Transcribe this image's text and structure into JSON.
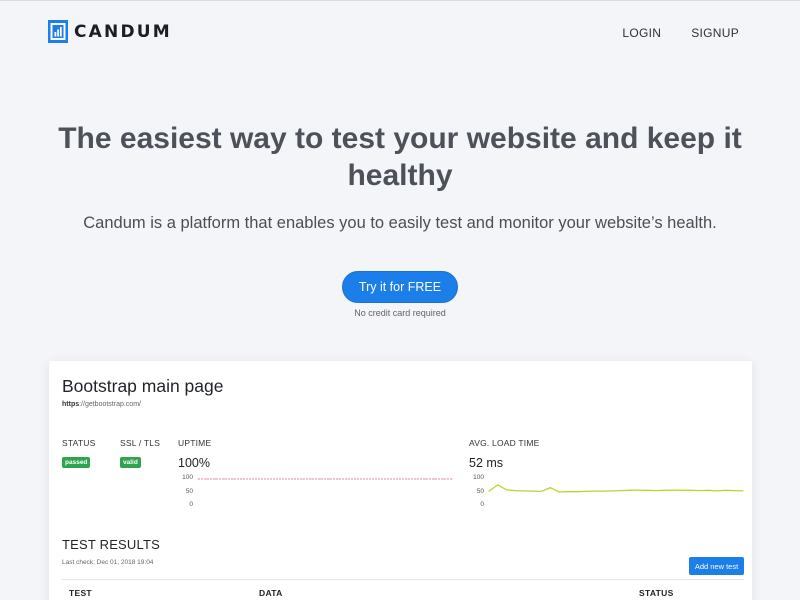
{
  "header": {
    "logo_text": "CANDUM",
    "nav": {
      "login": "LOGIN",
      "signup": "SIGNUP"
    }
  },
  "hero": {
    "title": "The easiest way to test your website and keep it healthy",
    "subtitle": "Candum is a platform that enables you to easily test and monitor your website’s health.",
    "cta_label": "Try it for FREE",
    "cta_note": "No credit card required"
  },
  "card": {
    "title": "Bootstrap main page",
    "url_scheme": "https",
    "url_rest": "://getbootstrap.com/",
    "status_label": "STATUS",
    "status_badge": "passed",
    "ssl_label": "SSL / TLS",
    "ssl_badge": "valid",
    "uptime": {
      "label": "UPTIME",
      "value": "100%",
      "ticks": [
        "100",
        "50",
        "0"
      ]
    },
    "load": {
      "label": "AVG. LOAD TIME",
      "value": "52 ms",
      "ticks": [
        "100",
        "50",
        "0"
      ]
    },
    "results": {
      "title": "TEST RESULTS",
      "last_check": "Last check: Dec 01, 2018 19:04",
      "add_label": "Add new test",
      "columns": [
        "TEST",
        "DATA",
        "STATUS"
      ]
    }
  },
  "colors": {
    "accent": "#1c7ee8",
    "badge_green": "#2ea44f",
    "uptime_line": "#e8a3ad",
    "load_line": "#b6d82c"
  },
  "chart_data": [
    {
      "type": "line",
      "name": "uptime",
      "ylim": [
        0,
        100
      ],
      "yticks": [
        100,
        50,
        0
      ],
      "values": [
        100,
        100,
        100,
        100,
        100,
        100,
        100,
        100,
        100,
        100,
        100,
        100,
        100,
        100,
        100,
        100,
        100,
        100,
        100,
        100,
        100,
        100,
        100,
        100,
        100,
        100,
        100,
        100,
        100,
        100
      ]
    },
    {
      "type": "line",
      "name": "avg_load_time",
      "ylim": [
        0,
        100
      ],
      "yticks": [
        100,
        50,
        0
      ],
      "values": [
        55,
        78,
        60,
        57,
        56,
        55,
        54,
        68,
        52,
        53,
        53,
        54,
        55,
        55,
        56,
        57,
        58,
        59,
        58,
        57,
        58,
        59,
        58,
        59,
        57,
        58,
        56,
        58,
        57,
        56
      ]
    }
  ]
}
